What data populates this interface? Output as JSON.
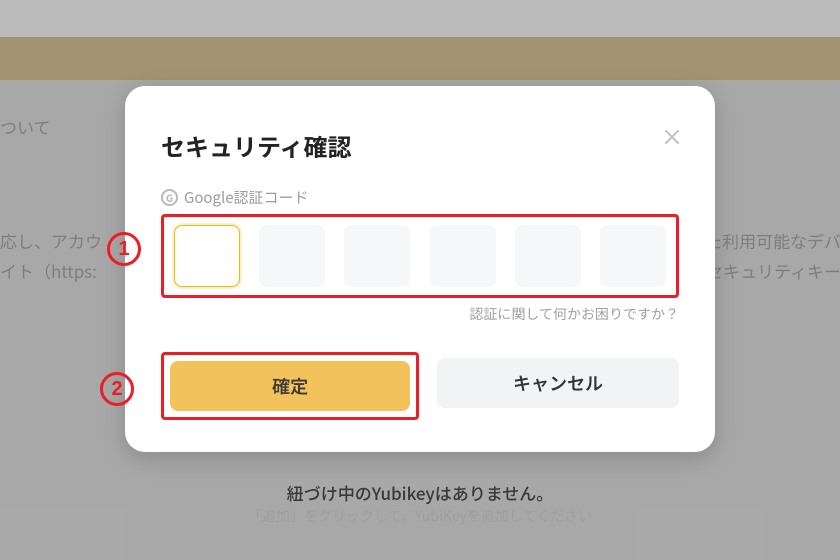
{
  "background": {
    "about": "ついて",
    "line1_left": "応し、アカウ",
    "line2_left": "イト（https:",
    "line1_right": "た利用可能なデバ",
    "line2_right": "セキュリティキー",
    "yubikey_empty": "紐づけ中のYubikeyはありません。",
    "yubikey_hint": "「追加」をクリックして、YubiKeyを追加してください"
  },
  "modal": {
    "title": "セキュリティ確認",
    "code_label": "Google認証コード",
    "help_text": "認証に関して何かお困りですか？",
    "confirm_label": "確定",
    "cancel_label": "キャンセル"
  },
  "callouts": {
    "one": "1",
    "two": "2"
  }
}
